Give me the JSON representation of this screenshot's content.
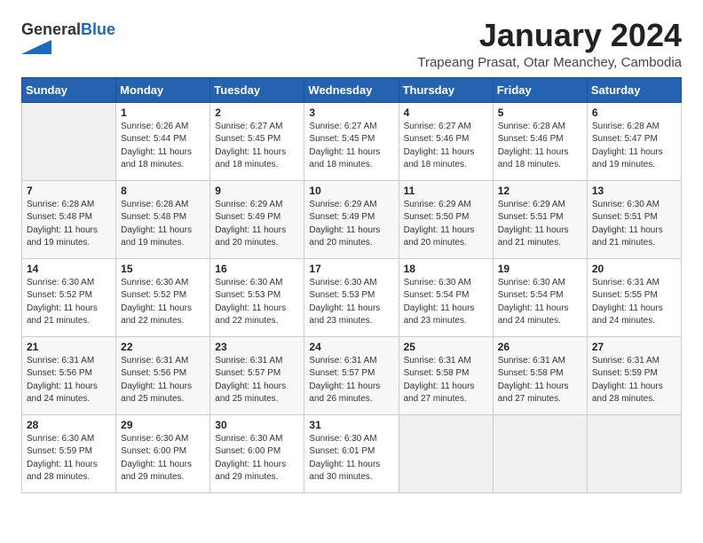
{
  "header": {
    "logo_general": "General",
    "logo_blue": "Blue",
    "title": "January 2024",
    "subtitle": "Trapeang Prasat, Otar Meanchey, Cambodia"
  },
  "columns": [
    "Sunday",
    "Monday",
    "Tuesday",
    "Wednesday",
    "Thursday",
    "Friday",
    "Saturday"
  ],
  "weeks": [
    [
      {
        "day": "",
        "empty": true
      },
      {
        "day": "1",
        "rise": "6:26 AM",
        "set": "5:44 PM",
        "daylight": "11 hours and 18 minutes."
      },
      {
        "day": "2",
        "rise": "6:27 AM",
        "set": "5:45 PM",
        "daylight": "11 hours and 18 minutes."
      },
      {
        "day": "3",
        "rise": "6:27 AM",
        "set": "5:45 PM",
        "daylight": "11 hours and 18 minutes."
      },
      {
        "day": "4",
        "rise": "6:27 AM",
        "set": "5:46 PM",
        "daylight": "11 hours and 18 minutes."
      },
      {
        "day": "5",
        "rise": "6:28 AM",
        "set": "5:46 PM",
        "daylight": "11 hours and 18 minutes."
      },
      {
        "day": "6",
        "rise": "6:28 AM",
        "set": "5:47 PM",
        "daylight": "11 hours and 19 minutes."
      }
    ],
    [
      {
        "day": "7",
        "rise": "6:28 AM",
        "set": "5:48 PM",
        "daylight": "11 hours and 19 minutes."
      },
      {
        "day": "8",
        "rise": "6:28 AM",
        "set": "5:48 PM",
        "daylight": "11 hours and 19 minutes."
      },
      {
        "day": "9",
        "rise": "6:29 AM",
        "set": "5:49 PM",
        "daylight": "11 hours and 20 minutes."
      },
      {
        "day": "10",
        "rise": "6:29 AM",
        "set": "5:49 PM",
        "daylight": "11 hours and 20 minutes."
      },
      {
        "day": "11",
        "rise": "6:29 AM",
        "set": "5:50 PM",
        "daylight": "11 hours and 20 minutes."
      },
      {
        "day": "12",
        "rise": "6:29 AM",
        "set": "5:51 PM",
        "daylight": "11 hours and 21 minutes."
      },
      {
        "day": "13",
        "rise": "6:30 AM",
        "set": "5:51 PM",
        "daylight": "11 hours and 21 minutes."
      }
    ],
    [
      {
        "day": "14",
        "rise": "6:30 AM",
        "set": "5:52 PM",
        "daylight": "11 hours and 21 minutes."
      },
      {
        "day": "15",
        "rise": "6:30 AM",
        "set": "5:52 PM",
        "daylight": "11 hours and 22 minutes."
      },
      {
        "day": "16",
        "rise": "6:30 AM",
        "set": "5:53 PM",
        "daylight": "11 hours and 22 minutes."
      },
      {
        "day": "17",
        "rise": "6:30 AM",
        "set": "5:53 PM",
        "daylight": "11 hours and 23 minutes."
      },
      {
        "day": "18",
        "rise": "6:30 AM",
        "set": "5:54 PM",
        "daylight": "11 hours and 23 minutes."
      },
      {
        "day": "19",
        "rise": "6:30 AM",
        "set": "5:54 PM",
        "daylight": "11 hours and 24 minutes."
      },
      {
        "day": "20",
        "rise": "6:31 AM",
        "set": "5:55 PM",
        "daylight": "11 hours and 24 minutes."
      }
    ],
    [
      {
        "day": "21",
        "rise": "6:31 AM",
        "set": "5:56 PM",
        "daylight": "11 hours and 24 minutes."
      },
      {
        "day": "22",
        "rise": "6:31 AM",
        "set": "5:56 PM",
        "daylight": "11 hours and 25 minutes."
      },
      {
        "day": "23",
        "rise": "6:31 AM",
        "set": "5:57 PM",
        "daylight": "11 hours and 25 minutes."
      },
      {
        "day": "24",
        "rise": "6:31 AM",
        "set": "5:57 PM",
        "daylight": "11 hours and 26 minutes."
      },
      {
        "day": "25",
        "rise": "6:31 AM",
        "set": "5:58 PM",
        "daylight": "11 hours and 27 minutes."
      },
      {
        "day": "26",
        "rise": "6:31 AM",
        "set": "5:58 PM",
        "daylight": "11 hours and 27 minutes."
      },
      {
        "day": "27",
        "rise": "6:31 AM",
        "set": "5:59 PM",
        "daylight": "11 hours and 28 minutes."
      }
    ],
    [
      {
        "day": "28",
        "rise": "6:30 AM",
        "set": "5:59 PM",
        "daylight": "11 hours and 28 minutes."
      },
      {
        "day": "29",
        "rise": "6:30 AM",
        "set": "6:00 PM",
        "daylight": "11 hours and 29 minutes."
      },
      {
        "day": "30",
        "rise": "6:30 AM",
        "set": "6:00 PM",
        "daylight": "11 hours and 29 minutes."
      },
      {
        "day": "31",
        "rise": "6:30 AM",
        "set": "6:01 PM",
        "daylight": "11 hours and 30 minutes."
      },
      {
        "day": "",
        "empty": true
      },
      {
        "day": "",
        "empty": true
      },
      {
        "day": "",
        "empty": true
      }
    ]
  ],
  "labels": {
    "sunrise": "Sunrise:",
    "sunset": "Sunset:",
    "daylight": "Daylight:"
  }
}
